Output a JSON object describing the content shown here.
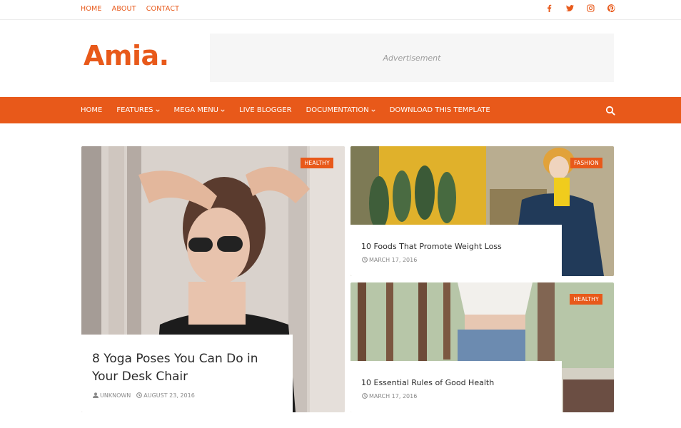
{
  "top_nav": [
    "HOME",
    "ABOUT",
    "CONTACT"
  ],
  "social_icons": [
    "facebook-icon",
    "twitter-icon",
    "instagram-icon",
    "pinterest-icon"
  ],
  "logo": "Amia.",
  "ad_label": "Advertisement",
  "main_menu": [
    {
      "label": "HOME",
      "dropdown": false
    },
    {
      "label": "FEATURES",
      "dropdown": true
    },
    {
      "label": "MEGA MENU",
      "dropdown": true
    },
    {
      "label": "LIVE BLOGGER",
      "dropdown": false
    },
    {
      "label": "DOCUMENTATION",
      "dropdown": true
    },
    {
      "label": "DOWNLOAD THIS TEMPLATE",
      "dropdown": false
    }
  ],
  "posts": {
    "featured": {
      "badge": "HEALTHY",
      "title": "8 Yoga Poses You Can Do in Your Desk Chair",
      "author": "UNKNOWN",
      "date": "AUGUST 23, 2016"
    },
    "second": {
      "badge": "FASHION",
      "title": "10 Foods That Promote Weight Loss",
      "date": "MARCH 17, 2016"
    },
    "third": {
      "badge": "HEALTHY",
      "title": "10 Essential Rules of Good Health",
      "date": "MARCH 17, 2016"
    }
  },
  "colors": {
    "accent": "#e8591a"
  }
}
